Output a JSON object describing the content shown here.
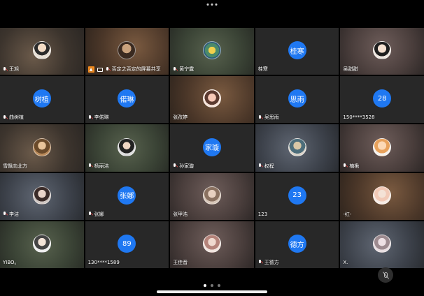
{
  "participants": [
    {
      "name": "王旭",
      "avatar_type": "photo",
      "muted": true
    },
    {
      "name": "否定之否定的屏幕共享",
      "avatar_type": "photo",
      "muted": true,
      "sharing": true
    },
    {
      "name": "黄宁露",
      "avatar_type": "photo",
      "muted": true
    },
    {
      "name": "桂寒",
      "avatar_type": "text",
      "avatar_text": "桂寒",
      "muted": false
    },
    {
      "name": "吴甜甜",
      "avatar_type": "photo",
      "muted": false
    },
    {
      "name": "曲树植",
      "avatar_type": "text",
      "avatar_text": "树植",
      "muted": true
    },
    {
      "name": "李偌琳",
      "avatar_type": "text",
      "avatar_text": "偌琳",
      "muted": true
    },
    {
      "name": "张孜婷",
      "avatar_type": "photo",
      "muted": false
    },
    {
      "name": "吴思雨",
      "avatar_type": "text",
      "avatar_text": "思雨",
      "muted": true
    },
    {
      "name": "150****3528",
      "avatar_type": "text",
      "avatar_text": "28",
      "muted": false
    },
    {
      "name": "雪飘向北方",
      "avatar_type": "photo",
      "muted": false
    },
    {
      "name": "杨丽洁",
      "avatar_type": "photo",
      "muted": true
    },
    {
      "name": "孙家璇",
      "avatar_type": "text",
      "avatar_text": "家璇",
      "muted": true
    },
    {
      "name": "权程",
      "avatar_type": "photo",
      "muted": true
    },
    {
      "name": "楠楸",
      "avatar_type": "photo",
      "muted": true
    },
    {
      "name": "李洁",
      "avatar_type": "photo",
      "muted": true
    },
    {
      "name": "张娜",
      "avatar_type": "text",
      "avatar_text": "张娜",
      "muted": true
    },
    {
      "name": "张甲浩",
      "avatar_type": "photo",
      "muted": false
    },
    {
      "name": "123",
      "avatar_type": "text",
      "avatar_text": "23",
      "muted": false
    },
    {
      "name": "-红-",
      "avatar_type": "photo",
      "muted": false
    },
    {
      "name": "YIBO。",
      "avatar_type": "photo",
      "muted": false
    },
    {
      "name": "130****1589",
      "avatar_type": "text",
      "avatar_text": "89",
      "muted": false
    },
    {
      "name": "王佳音",
      "avatar_type": "photo",
      "muted": false
    },
    {
      "name": "王德方",
      "avatar_type": "text",
      "avatar_text": "德方",
      "muted": true
    },
    {
      "name": "X.",
      "avatar_type": "photo",
      "muted": false
    }
  ],
  "colors": {
    "accent_blue": "#1f78f2",
    "share_orange": "#f28b1f",
    "muted_red": "#e94545",
    "background": "#000000"
  },
  "pagination": {
    "total_pages": 3,
    "current_page": 1
  },
  "icons": {
    "top_more": "more-horizontal-icon",
    "floating_mic": "mic-muted-icon"
  }
}
